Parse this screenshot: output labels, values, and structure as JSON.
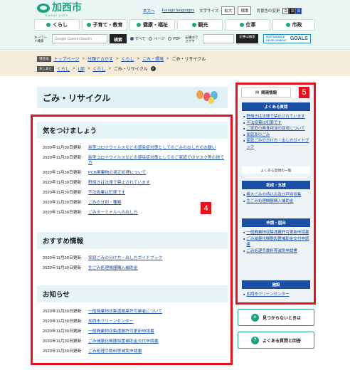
{
  "header": {
    "logo_text": "加西市",
    "logo_sub": "KASAI CITY",
    "links": [
      "本文へ",
      "Foreign languages"
    ],
    "font_size_label": "文字サイズ",
    "font_btns": [
      "拡大",
      "標準"
    ],
    "bg_label": "背景色の変更",
    "color_btns": [
      "白",
      "黒",
      "青"
    ],
    "nav": [
      "くらし",
      "子育て・教育",
      "健康・福祉",
      "観光",
      "仕事",
      "市政"
    ],
    "search_label": "キーワード検索",
    "search_placeholder": "Google Custom Search",
    "search_btn": "検索",
    "radios": [
      "すべて",
      "ページ",
      "PDF"
    ],
    "page_id_label": "記事IDでさがす",
    "page_id_btn": "記事ID検索",
    "sdg_small": "SUSTAINABLE DEVELOPMENT",
    "sdg_big": "GOALS"
  },
  "breadcrumb": {
    "current_tag": "現在地",
    "current": [
      "トップページ",
      "分類でさがす",
      "くらし",
      "ごみ・環境",
      "ごみ・リサイクル"
    ],
    "history_tag": "あしあと",
    "history": [
      "くらし",
      "L部",
      "くらし",
      "ごみ・リサイクル"
    ]
  },
  "main": {
    "title": "ごみ・リサイクル",
    "badge": "4",
    "sections": [
      {
        "heading": "気をつけましょう",
        "items": [
          {
            "date": "2020年11月30日更新",
            "text": "新型コロナウイルスなどの感染症対策としてのごみの出し方のお願い"
          },
          {
            "date": "2020年11月30日更新",
            "text": "新型コロナウイルスなどの感染症対策としてのご家庭でのマスク等の捨て方"
          },
          {
            "date": "2020年11月30日更新",
            "text": "PCB廃棄物の適正処理について"
          },
          {
            "date": "2020年11月30日更新",
            "text": "野焼きは法律で禁止されています"
          },
          {
            "date": "2020年11月30日更新",
            "text": "不法投棄は犯罪です"
          },
          {
            "date": "2020年11月30日更新",
            "text": "ごみの分別・種類"
          },
          {
            "date": "2020年11月30日更新",
            "text": "ごみターミナルへの出し方"
          }
        ]
      },
      {
        "heading": "おすすめ情報",
        "items": [
          {
            "date": "2020年11月30日更新",
            "text": "家庭ごみの分け方・出し方ガイドブック"
          },
          {
            "date": "2020年11月30日更新",
            "text": "生ごみ処理機器購入補助金"
          }
        ]
      },
      {
        "heading": "お知らせ",
        "items": [
          {
            "date": "2020年11月30日更新",
            "text": "一般廃棄物収集運搬業許可業者について"
          },
          {
            "date": "2020年11月30日更新",
            "text": "加西市クリーンセンター"
          },
          {
            "date": "2020年11月30日更新",
            "text": "一般廃棄物収集運搬許可更新申請書"
          },
          {
            "date": "2020年11月30日更新",
            "text": "ごみ減量化機器設置補助金交付申請書"
          },
          {
            "date": "2020年11月30日更新",
            "text": "ごみ処理手数料等減免申請書"
          }
        ]
      }
    ]
  },
  "side": {
    "tab_label": "関連情報",
    "badge": "5",
    "groups": [
      {
        "heading": "よくある質問",
        "items": [
          "野焼きは法律で禁止されています",
          "不法投棄は犯罪です",
          "ご家庭の廃食用油の回収について",
          "家庭系のごみ",
          "家庭ごみの分け方・出し方ガイドブック"
        ],
        "more": "よくある質問の一覧"
      },
      {
        "heading": "助成・支援",
        "items": [
          "粗大ごみの持込み及び戸別収集",
          "生ごみ処理機器購入補助金"
        ]
      },
      {
        "heading": "申請・届出",
        "items": [
          "一般廃棄物収集運搬許可更新申請書",
          "ごみ減量化機器設置補助金交付申請書",
          "ごみ処理手数料等減免申請書"
        ]
      },
      {
        "heading": "施設",
        "items": [
          "加西市クリーンセンター"
        ]
      }
    ],
    "buttons": [
      "見つからないときは",
      "よくある質問と回答"
    ]
  }
}
